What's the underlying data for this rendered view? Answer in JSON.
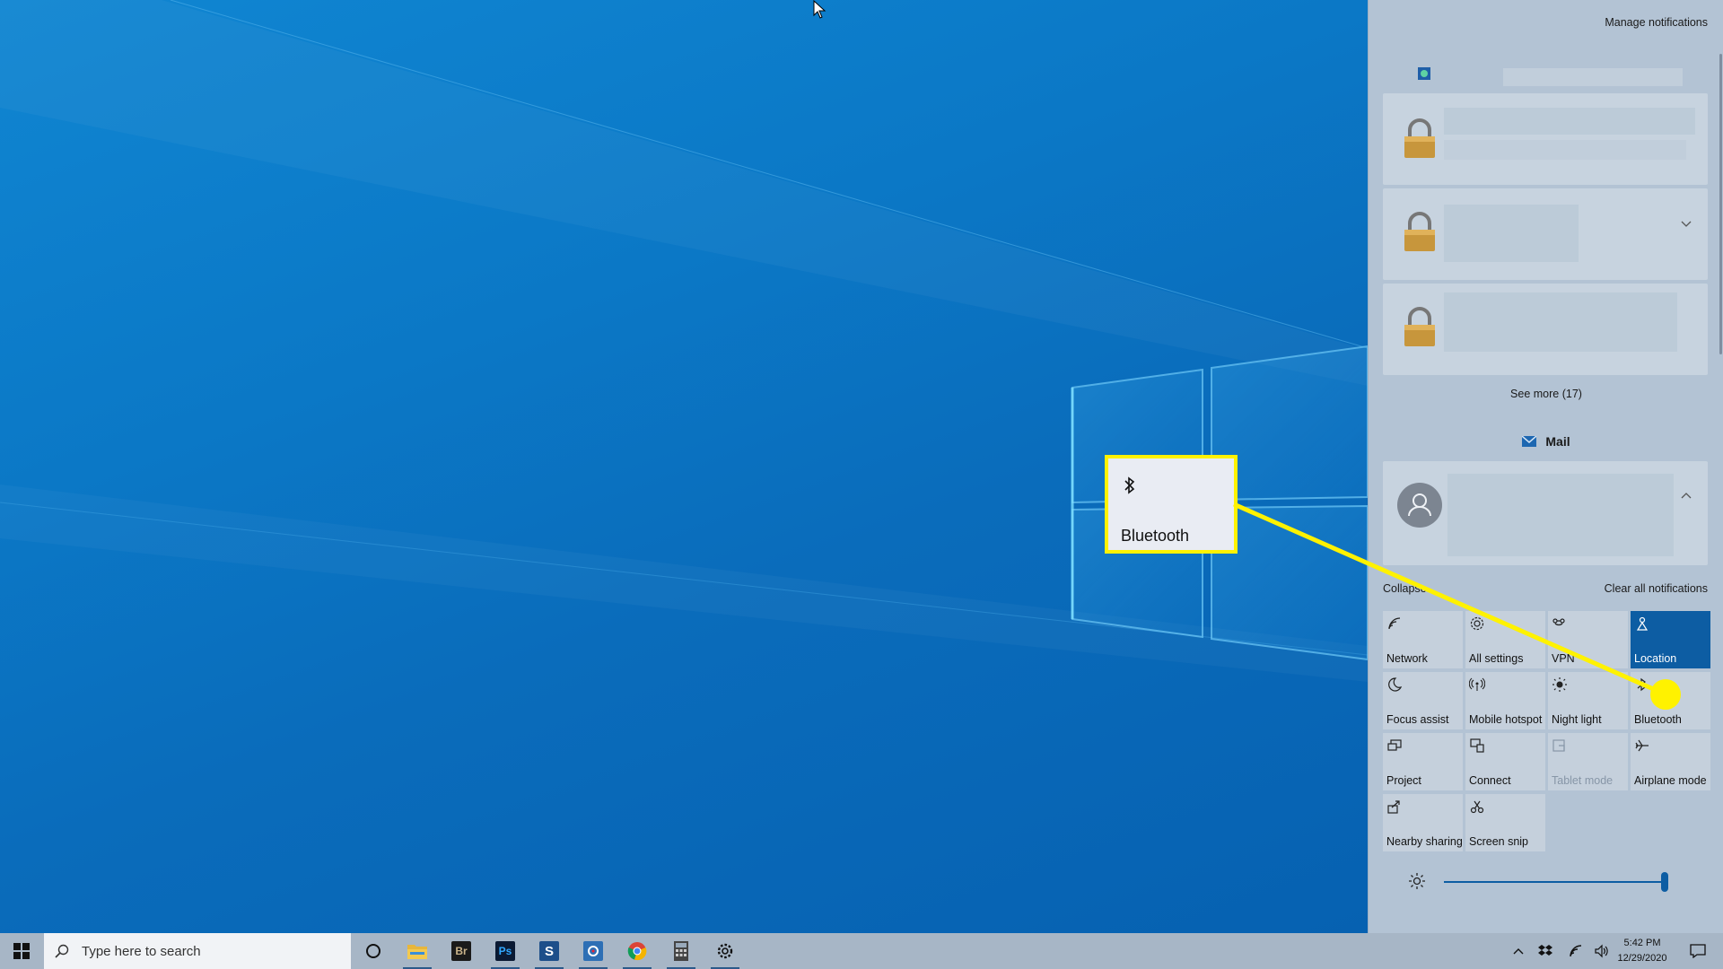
{
  "desktop": {
    "callout": {
      "label": "Bluetooth",
      "icon": "bluetooth-icon",
      "border_color": "#fff200"
    }
  },
  "action_center": {
    "manage_notifications": "Manage notifications",
    "see_more": "See more (17)",
    "mail_group": "Mail",
    "collapse": "Collapse",
    "clear_all": "Clear all notifications",
    "tiles": [
      {
        "label": "Network",
        "icon": "network-icon",
        "state": "off"
      },
      {
        "label": "All settings",
        "icon": "gear-icon",
        "state": "off"
      },
      {
        "label": "VPN",
        "icon": "vpn-icon",
        "state": "off"
      },
      {
        "label": "Location",
        "icon": "location-icon",
        "state": "on"
      },
      {
        "label": "Focus assist",
        "icon": "moon-icon",
        "state": "off"
      },
      {
        "label": "Mobile hotspot",
        "icon": "hotspot-icon",
        "state": "off"
      },
      {
        "label": "Night light",
        "icon": "sun-icon",
        "state": "off"
      },
      {
        "label": "Bluetooth",
        "icon": "bluetooth-icon",
        "state": "off"
      },
      {
        "label": "Project",
        "icon": "project-icon",
        "state": "off"
      },
      {
        "label": "Connect",
        "icon": "connect-icon",
        "state": "off"
      },
      {
        "label": "Tablet mode",
        "icon": "tablet-icon",
        "state": "disabled"
      },
      {
        "label": "Airplane mode",
        "icon": "airplane-icon",
        "state": "off"
      },
      {
        "label": "Nearby sharing",
        "icon": "share-icon",
        "state": "off"
      },
      {
        "label": "Screen snip",
        "icon": "snip-icon",
        "state": "off"
      }
    ],
    "brightness": {
      "level": 1.0,
      "icon": "brightness-icon"
    },
    "accent_color": "#0d5da3",
    "highlight_color": "#fff200"
  },
  "taskbar": {
    "search_placeholder": "Type here to search",
    "apps": [
      {
        "name": "cortana-icon"
      },
      {
        "name": "file-explorer-icon",
        "running": true
      },
      {
        "name": "adobe-bridge-icon",
        "text": "Br"
      },
      {
        "name": "photoshop-icon",
        "text": "Ps",
        "running": true
      },
      {
        "name": "snagit-icon",
        "text": "S",
        "running": true
      },
      {
        "name": "app-icon",
        "running": true
      },
      {
        "name": "chrome-icon",
        "running": true
      },
      {
        "name": "calculator-icon",
        "running": true
      },
      {
        "name": "settings-icon",
        "running": true
      }
    ],
    "time": "5:42 PM",
    "date": "12/29/2020"
  }
}
